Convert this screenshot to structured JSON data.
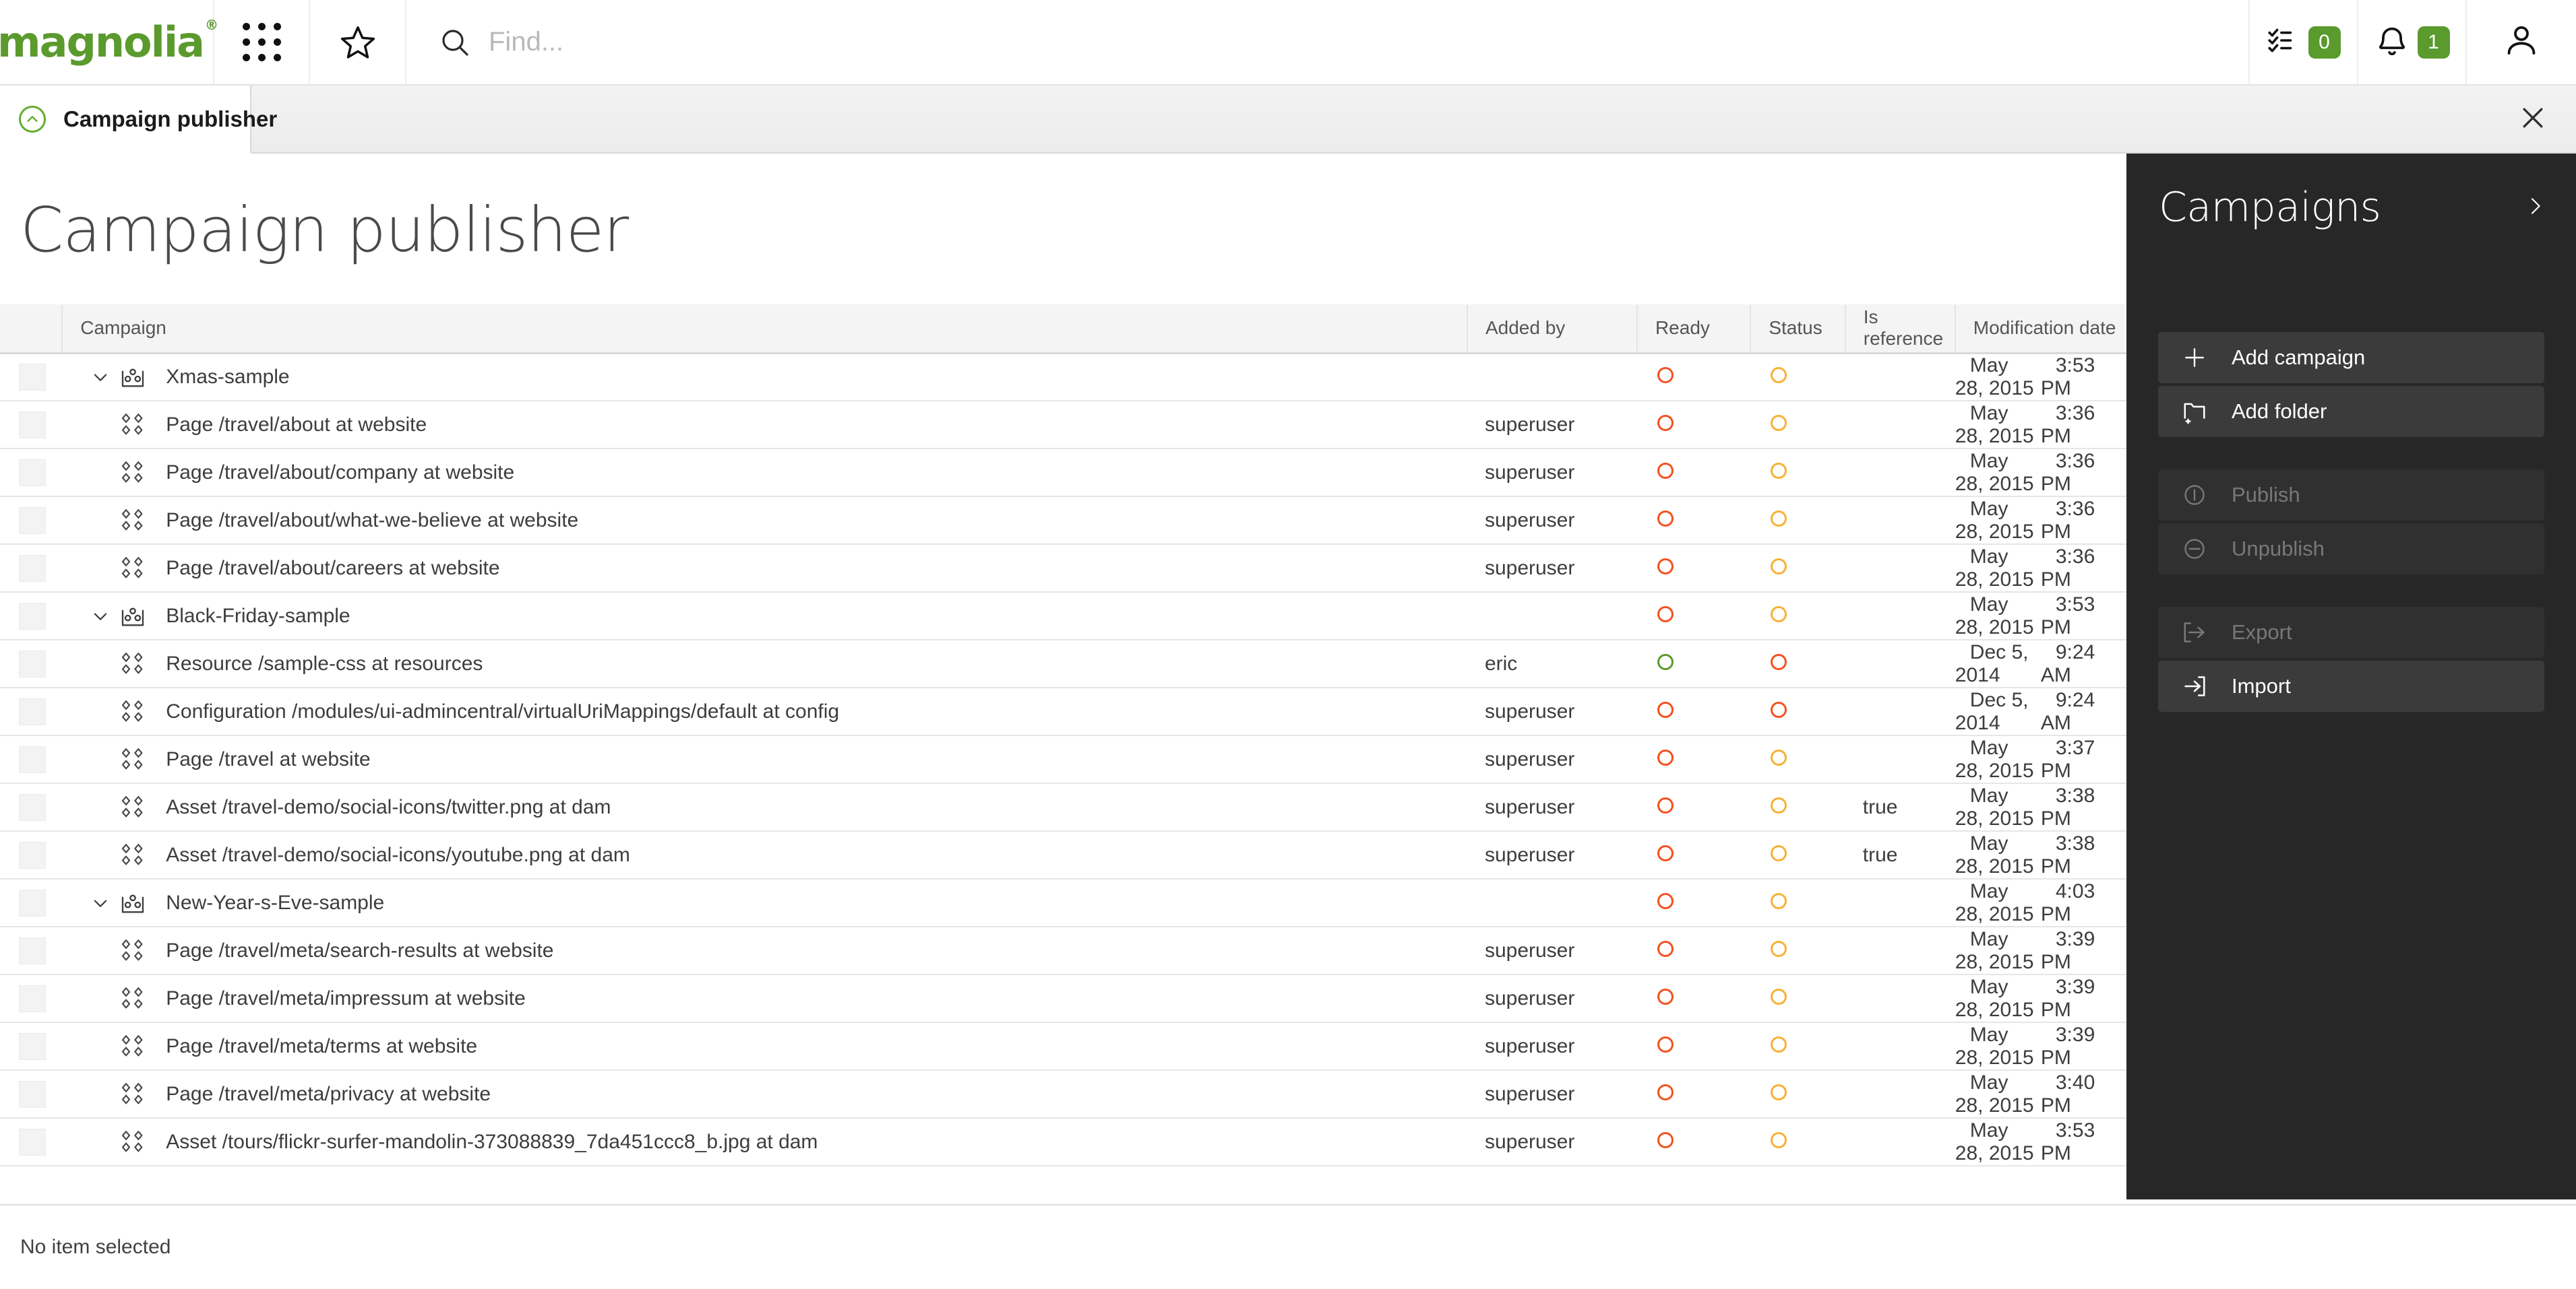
{
  "topbar": {
    "logo": "magnolia",
    "logo_tm": "®",
    "apps_icon": "apps-grid-icon",
    "favorites_icon": "star-icon",
    "search": {
      "placeholder": "Find...",
      "value": "",
      "icon": "search-icon"
    },
    "tasks": {
      "icon": "tasks-checklist-icon",
      "badge": "0"
    },
    "notifications": {
      "icon": "bell-icon",
      "badge": "1"
    },
    "user": {
      "icon": "user-avatar-icon"
    },
    "accent_green": "#5b9a2d"
  },
  "tabbar": {
    "tabs": [
      {
        "label": "Campaign publisher",
        "icon": "campaign-publisher-icon",
        "active": true
      }
    ],
    "close_label": "close-icon"
  },
  "page": {
    "title": "Campaign publisher"
  },
  "table": {
    "columns": [
      "Campaign",
      "Added by",
      "Ready",
      "Status",
      "Is reference",
      "Modification date"
    ],
    "rows": [
      {
        "type": "group",
        "label": "Xmas-sample",
        "added_by": "",
        "ready": "red",
        "status": "yellow",
        "is_reference": "",
        "date": "May 28, 2015",
        "time": "3:53 PM"
      },
      {
        "type": "child",
        "label": "Page /travel/about at website",
        "added_by": "superuser",
        "ready": "red",
        "status": "yellow",
        "is_reference": "",
        "date": "May 28, 2015",
        "time": "3:36 PM"
      },
      {
        "type": "child",
        "label": "Page /travel/about/company at website",
        "added_by": "superuser",
        "ready": "red",
        "status": "yellow",
        "is_reference": "",
        "date": "May 28, 2015",
        "time": "3:36 PM"
      },
      {
        "type": "child",
        "label": "Page /travel/about/what-we-believe at website",
        "added_by": "superuser",
        "ready": "red",
        "status": "yellow",
        "is_reference": "",
        "date": "May 28, 2015",
        "time": "3:36 PM"
      },
      {
        "type": "child",
        "label": "Page /travel/about/careers at website",
        "added_by": "superuser",
        "ready": "red",
        "status": "yellow",
        "is_reference": "",
        "date": "May 28, 2015",
        "time": "3:36 PM"
      },
      {
        "type": "group",
        "label": "Black-Friday-sample",
        "added_by": "",
        "ready": "red",
        "status": "yellow",
        "is_reference": "",
        "date": "May 28, 2015",
        "time": "3:53 PM"
      },
      {
        "type": "child",
        "label": "Resource /sample-css at resources",
        "added_by": "eric",
        "ready": "green",
        "status": "red",
        "is_reference": "",
        "date": "Dec 5, 2014",
        "time": "9:24 AM"
      },
      {
        "type": "child",
        "label": "Configuration /modules/ui-admincentral/virtualUriMappings/default at config",
        "added_by": "superuser",
        "ready": "red",
        "status": "red",
        "is_reference": "",
        "date": "Dec 5, 2014",
        "time": "9:24 AM"
      },
      {
        "type": "child",
        "label": "Page /travel at website",
        "added_by": "superuser",
        "ready": "red",
        "status": "yellow",
        "is_reference": "",
        "date": "May 28, 2015",
        "time": "3:37 PM"
      },
      {
        "type": "child",
        "label": "Asset /travel-demo/social-icons/twitter.png at dam",
        "added_by": "superuser",
        "ready": "red",
        "status": "yellow",
        "is_reference": "true",
        "date": "May 28, 2015",
        "time": "3:38 PM"
      },
      {
        "type": "child",
        "label": "Asset /travel-demo/social-icons/youtube.png at dam",
        "added_by": "superuser",
        "ready": "red",
        "status": "yellow",
        "is_reference": "true",
        "date": "May 28, 2015",
        "time": "3:38 PM"
      },
      {
        "type": "group",
        "label": "New-Year-s-Eve-sample",
        "added_by": "",
        "ready": "red",
        "status": "yellow",
        "is_reference": "",
        "date": "May 28, 2015",
        "time": "4:03 PM"
      },
      {
        "type": "child",
        "label": "Page /travel/meta/search-results at website",
        "added_by": "superuser",
        "ready": "red",
        "status": "yellow",
        "is_reference": "",
        "date": "May 28, 2015",
        "time": "3:39 PM"
      },
      {
        "type": "child",
        "label": "Page /travel/meta/impressum at website",
        "added_by": "superuser",
        "ready": "red",
        "status": "yellow",
        "is_reference": "",
        "date": "May 28, 2015",
        "time": "3:39 PM"
      },
      {
        "type": "child",
        "label": "Page /travel/meta/terms at website",
        "added_by": "superuser",
        "ready": "red",
        "status": "yellow",
        "is_reference": "",
        "date": "May 28, 2015",
        "time": "3:39 PM"
      },
      {
        "type": "child",
        "label": "Page /travel/meta/privacy at website",
        "added_by": "superuser",
        "ready": "red",
        "status": "yellow",
        "is_reference": "",
        "date": "May 28, 2015",
        "time": "3:40 PM"
      },
      {
        "type": "child",
        "label": "Asset /tours/flickr-surfer-mandolin-373088839_7da451ccc8_b.jpg at dam",
        "added_by": "superuser",
        "ready": "red",
        "status": "yellow",
        "is_reference": "",
        "date": "May 28, 2015",
        "time": "3:53 PM"
      }
    ],
    "status_colors": {
      "red": "#f4511e",
      "yellow": "#f8b133",
      "green": "#5b9a2d"
    }
  },
  "action_panel": {
    "title": "Campaigns",
    "collapse_icon": "chevron-right-icon",
    "groups": [
      {
        "items": [
          {
            "label": "Add campaign",
            "icon": "plus-icon",
            "enabled": true
          },
          {
            "label": "Add folder",
            "icon": "folder-plus-icon",
            "enabled": true
          }
        ]
      },
      {
        "items": [
          {
            "label": "Publish",
            "icon": "publish-icon",
            "enabled": false
          },
          {
            "label": "Unpublish",
            "icon": "unpublish-icon",
            "enabled": false
          }
        ]
      },
      {
        "items": [
          {
            "label": "Export",
            "icon": "export-icon",
            "enabled": false
          },
          {
            "label": "Import",
            "icon": "import-icon",
            "enabled": true
          }
        ]
      }
    ]
  },
  "footer": {
    "status": "No item selected"
  }
}
